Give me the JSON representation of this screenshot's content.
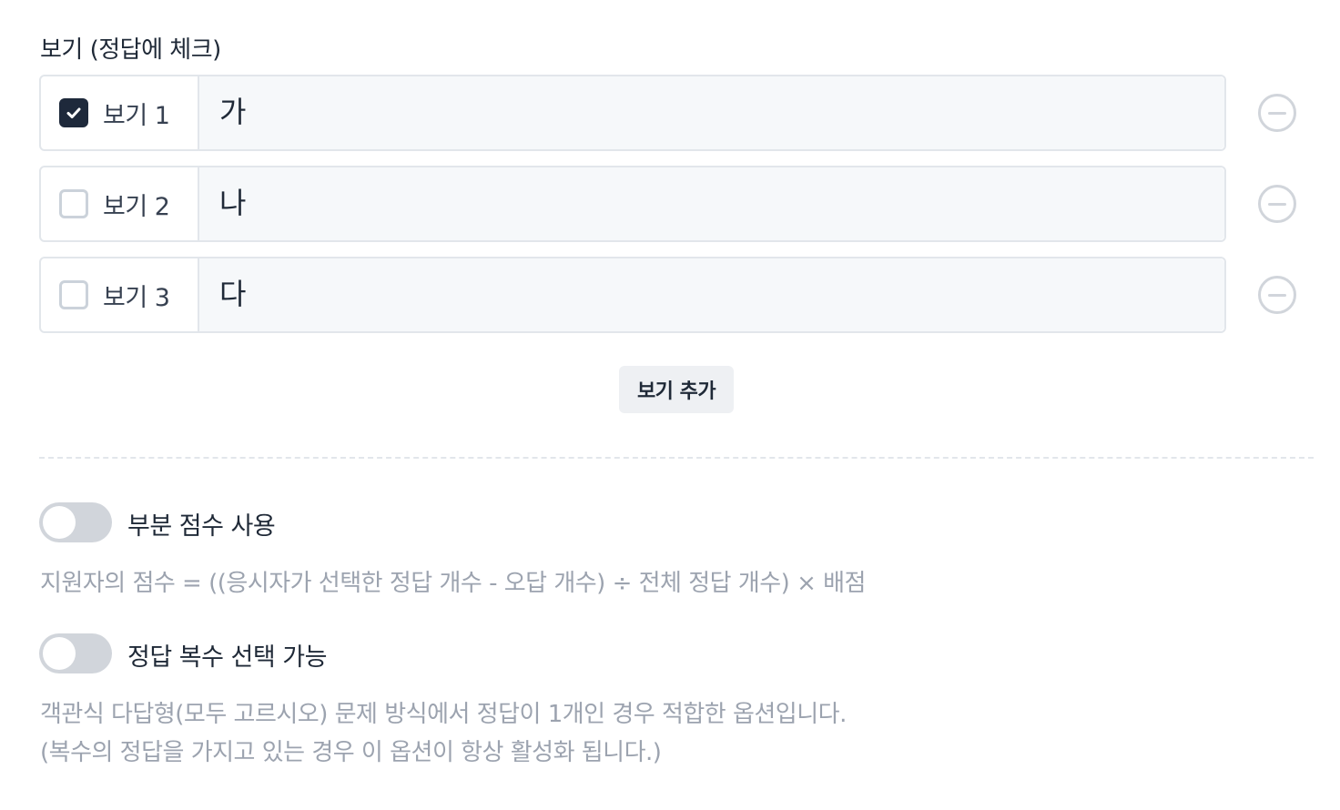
{
  "section": {
    "title": "보기 (정답에 체크)"
  },
  "options": [
    {
      "label": "보기 1",
      "value": "가",
      "checked": true
    },
    {
      "label": "보기 2",
      "value": "나",
      "checked": false
    },
    {
      "label": "보기 3",
      "value": "다",
      "checked": false
    }
  ],
  "add_option": {
    "label": "보기 추가"
  },
  "partial_score": {
    "label": "부분 점수 사용",
    "enabled": false,
    "help": "지원자의 점수 = ((응시자가 선택한 정답 개수 - 오답 개수) ÷ 전체 정답 개수) × 배점"
  },
  "multi_answer": {
    "label": "정답 복수 선택 가능",
    "enabled": false,
    "help_line1": "객관식 다답형(모두 고르시오) 문제 방식에서 정답이 1개인 경우 적합한 옵션입니다.",
    "help_line2": "(복수의 정답을 가지고 있는 경우 이 옵션이 항상 활성화 됩니다.)"
  },
  "colors": {
    "accent": "#1e293b",
    "border": "#e2e6eb",
    "muted_text": "#9ca3af",
    "toggle_off": "#d1d5db"
  }
}
